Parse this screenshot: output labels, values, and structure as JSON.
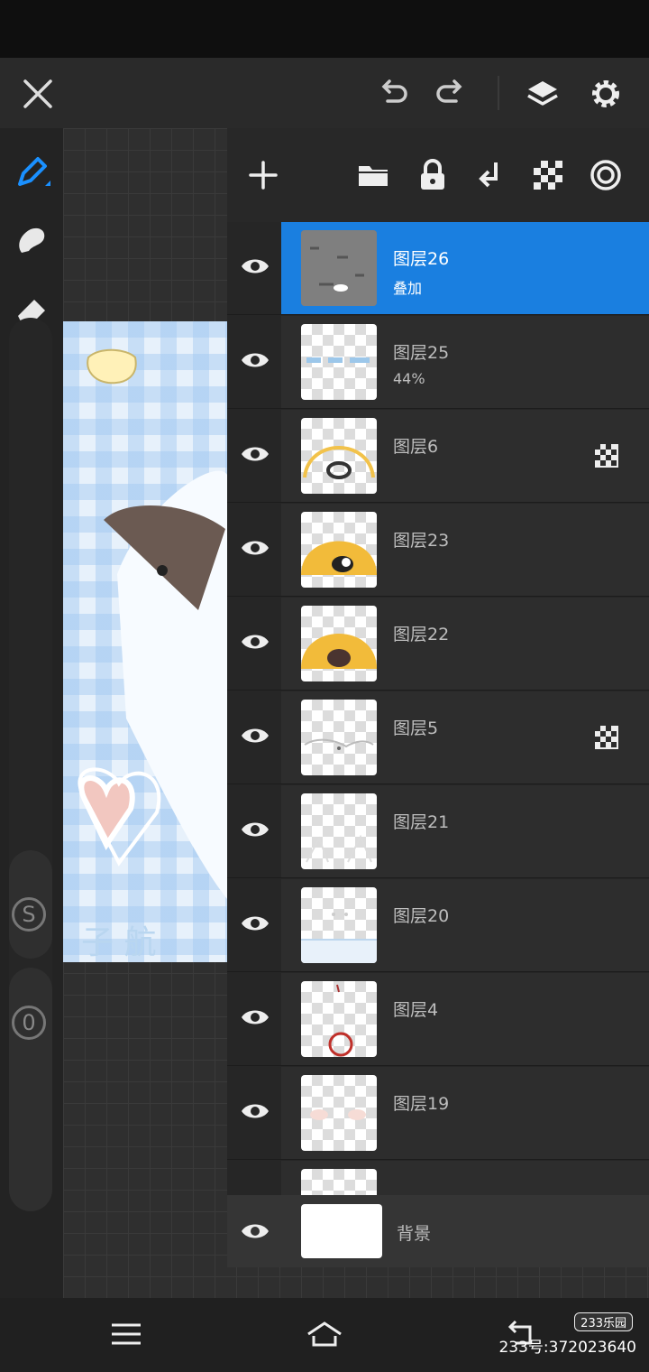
{
  "colors": {
    "accent": "#1a7fe0",
    "current_color": "#9fd0ff"
  },
  "toolbar": {
    "icons": [
      "close-icon",
      "undo-icon",
      "redo-icon",
      "layers-icon",
      "gear-icon"
    ]
  },
  "tools": {
    "icons": [
      "pen-icon",
      "smudge-icon",
      "eraser-icon",
      "color-picker",
      "leaf-icon",
      "grid-icon"
    ],
    "size_knob_label": "S",
    "opacity_knob_label": "0"
  },
  "layers_panel": {
    "toolbar_icons": [
      "add-icon",
      "folder-icon",
      "lock-icon",
      "merge-down-icon",
      "checker-icon",
      "target-icon"
    ],
    "layers": [
      {
        "name": "图层26",
        "sub": "叠加",
        "selected": true
      },
      {
        "name": "图层25",
        "sub": "44%"
      },
      {
        "name": "图层6",
        "alpha_lock": true
      },
      {
        "name": "图层23"
      },
      {
        "name": "图层22"
      },
      {
        "name": "图层5",
        "alpha_lock": true
      },
      {
        "name": "图层21"
      },
      {
        "name": "图层20"
      },
      {
        "name": "图层4"
      },
      {
        "name": "图层19"
      }
    ],
    "background_layer": {
      "name": "背景"
    }
  },
  "bottom_nav": {
    "icons": [
      "menu-icon",
      "home-icon",
      "back-icon"
    ],
    "watermark_logo": "233乐园",
    "watermark_text": "233号:372023640"
  }
}
